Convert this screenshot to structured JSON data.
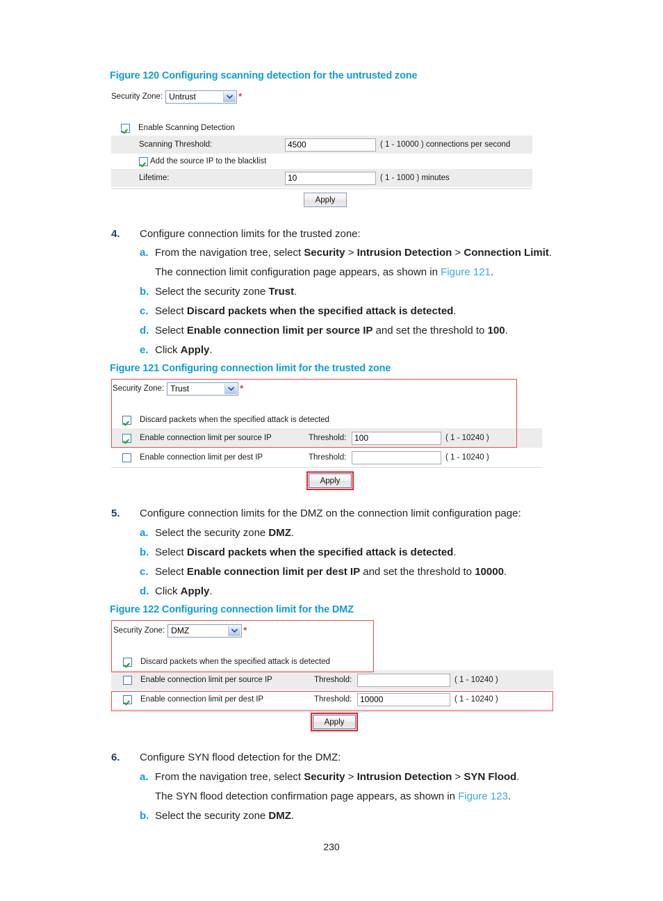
{
  "figure120": {
    "caption": "Figure 120 Configuring scanning detection for the untrusted zone",
    "zone_label": "Security Zone:",
    "zone_value": "Untrust",
    "required_mark": "*",
    "enable_scanning_label": "Enable Scanning Detection",
    "scanning_threshold_label": "Scanning Threshold:",
    "scanning_threshold_value": "4500",
    "scanning_threshold_hint": "( 1 - 10000 ) connections per second",
    "blacklist_label": "Add the source IP to the blacklist",
    "lifetime_label": "Lifetime:",
    "lifetime_value": "10",
    "lifetime_hint": "( 1 - 1000 ) minutes",
    "apply_label": "Apply"
  },
  "step4": {
    "number": "4.",
    "text": "Configure connection limits for the trusted zone:",
    "a_letter": "a.",
    "a_text_1": "From the navigation tree, select ",
    "a_bold_1": "Security",
    "a_gt_1": " > ",
    "a_bold_2": "Intrusion Detection",
    "a_gt_2": " > ",
    "a_bold_3": "Connection Limit",
    "a_period": ".",
    "a_cont_1": "The connection limit configuration page appears, as shown in ",
    "a_cont_link": "Figure 121",
    "a_cont_period": ".",
    "b_letter": "b.",
    "b_text": "Select the security zone ",
    "b_bold": "Trust",
    "b_period": ".",
    "c_letter": "c.",
    "c_text": "Select ",
    "c_bold": "Discard packets when the specified attack is detected",
    "c_period": ".",
    "d_letter": "d.",
    "d_text_1": "Select ",
    "d_bold_1": "Enable connection limit per source IP",
    "d_text_2": " and set the threshold to ",
    "d_bold_2": "100",
    "d_period": ".",
    "e_letter": "e.",
    "e_text": "Click ",
    "e_bold": "Apply",
    "e_period": "."
  },
  "figure121": {
    "caption": "Figure 121 Configuring connection limit for the trusted zone",
    "zone_label": "Security Zone:",
    "zone_value": "Trust",
    "required_mark": "*",
    "discard_label": "Discard packets when the specified attack is detected",
    "src_label": "Enable connection limit per source IP",
    "src_threshold_label": "Threshold:",
    "src_threshold_value": "100",
    "src_hint": "( 1 - 10240 )",
    "dst_label": "Enable connection limit per dest IP",
    "dst_threshold_label": "Threshold:",
    "dst_threshold_value": "",
    "dst_hint": "( 1 - 10240 )",
    "apply_label": "Apply"
  },
  "step5": {
    "number": "5.",
    "text": "Configure connection limits for the DMZ on the connection limit configuration page:",
    "a_letter": "a.",
    "a_text": "Select the security zone ",
    "a_bold": "DMZ",
    "a_period": ".",
    "b_letter": "b.",
    "b_text": "Select ",
    "b_bold": "Discard packets when the specified attack is detected",
    "b_period": ".",
    "c_letter": "c.",
    "c_text_1": "Select ",
    "c_bold_1": "Enable connection limit per dest IP",
    "c_text_2": " and set the threshold to ",
    "c_bold_2": "10000",
    "c_period": ".",
    "d_letter": "d.",
    "d_text": "Click ",
    "d_bold": "Apply",
    "d_period": "."
  },
  "figure122": {
    "caption": "Figure 122 Configuring connection limit for the DMZ",
    "zone_label": "Security Zone:",
    "zone_value": "DMZ",
    "required_mark": "*",
    "discard_label": "Discard packets when the specified attack is detected",
    "src_label": "Enable connection limit per source IP",
    "src_threshold_label": "Threshold:",
    "src_threshold_value": "",
    "src_hint": "( 1 - 10240 )",
    "dst_label": "Enable connection limit per dest IP",
    "dst_threshold_label": "Threshold:",
    "dst_threshold_value": "10000",
    "dst_hint": "( 1 - 10240 )",
    "apply_label": "Apply"
  },
  "step6": {
    "number": "6.",
    "text": "Configure SYN flood detection for the DMZ:",
    "a_letter": "a.",
    "a_text_1": "From the navigation tree, select ",
    "a_bold_1": "Security",
    "a_gt_1": " > ",
    "a_bold_2": "Intrusion Detection",
    "a_gt_2": " > ",
    "a_bold_3": "SYN Flood",
    "a_period": ".",
    "a_cont_1": "The SYN flood detection confirmation page appears, as shown in ",
    "a_cont_link": "Figure 123",
    "a_cont_period": ".",
    "b_letter": "b.",
    "b_text": "Select the security zone ",
    "b_bold": "DMZ",
    "b_period": "."
  },
  "footer": {
    "page_number": "230"
  }
}
